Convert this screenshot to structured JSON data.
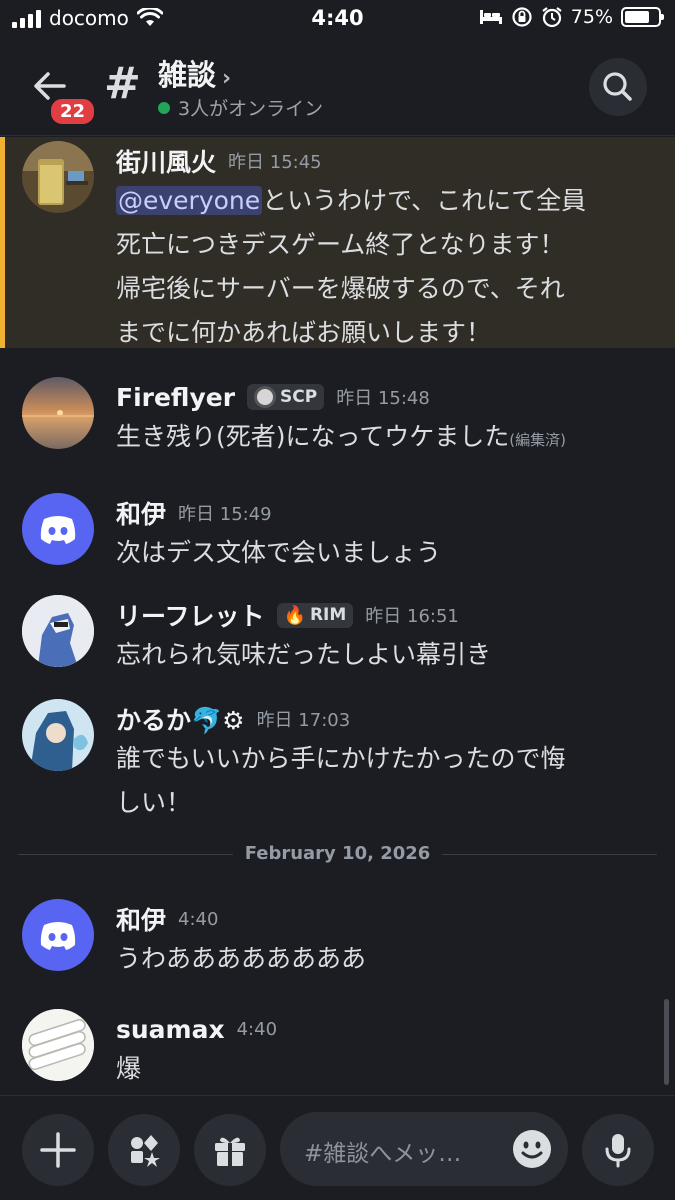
{
  "status_bar": {
    "carrier": "docomo",
    "time": "4:40",
    "battery": "75%",
    "battery_level": 0.75
  },
  "header": {
    "unread_badge": "22",
    "channel_name": "雑談",
    "online_status": "3人がオンライン"
  },
  "messages": [
    {
      "author": "街川風火",
      "timestamp": "昨日 15:45",
      "mention": "@everyone",
      "text_line1": "というわけで、これにて全員",
      "text_line2": "死亡につきデスゲーム終了となります！",
      "text_line3": "帰宅後にサーバーを爆破するので、それ",
      "text_line4": "までに何かあればお願いします！"
    },
    {
      "author": "Fireflyer",
      "tag": "SCP",
      "timestamp": "昨日 15:48",
      "text": "生き残り(死者)になってウケました",
      "edited": "(編集済)"
    },
    {
      "author": "和伊",
      "timestamp": "昨日 15:49",
      "text": "次はデス文体で会いましょう"
    },
    {
      "author": "リーフレット",
      "tag": "RIM",
      "timestamp": "昨日 16:51",
      "text": "忘れられ気味だったしよい幕引き"
    },
    {
      "author": "かるか",
      "author_emoji": "🐬⚙",
      "timestamp": "昨日 17:03",
      "text_line1": "誰でもいいから手にかけたかったので悔",
      "text_line2": "しい！"
    },
    {
      "author": "和伊",
      "timestamp": "4:40",
      "text": "うわああああああああ"
    },
    {
      "author": "suamax",
      "timestamp": "4:40",
      "text": "爆"
    }
  ],
  "date_divider": "February 10, 2026",
  "composer": {
    "placeholder": "#雑談へメッ…"
  },
  "colors": {
    "background": "#1c1d22",
    "highlight": "#f0b232",
    "blurple": "#5865f2",
    "online": "#23a559",
    "badge": "#e03e42"
  }
}
